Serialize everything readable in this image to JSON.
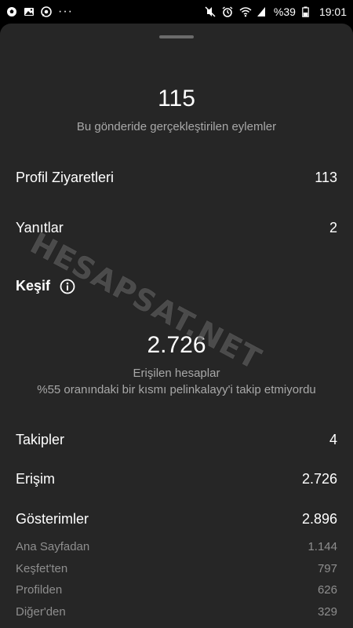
{
  "status_bar": {
    "battery": "%39",
    "time": "19:01",
    "left_icons": [
      "soccer-ball-icon",
      "gallery-icon",
      "whatsapp-icon"
    ],
    "more": "···",
    "right_icons": [
      "mute-icon",
      "alarm-icon",
      "wifi-icon",
      "signal-icon",
      "battery-icon"
    ]
  },
  "summary": {
    "actions_count": "115",
    "actions_caption": "Bu gönderide gerçekleştirilen eylemler"
  },
  "actions": [
    {
      "label": "Profil Ziyaretleri",
      "value": "113"
    },
    {
      "label": "Yanıtlar",
      "value": "2"
    }
  ],
  "discovery": {
    "title": "Keşif",
    "reach_count": "2.726",
    "reach_caption": "Erişilen hesaplar",
    "reach_note": "%55 oranındaki bir kısmı pelinkalayy'i takip etmiyordu"
  },
  "metrics": [
    {
      "label": "Takipler",
      "value": "4"
    },
    {
      "label": "Erişim",
      "value": "2.726"
    },
    {
      "label": "Gösterimler",
      "value": "2.896"
    }
  ],
  "impressions_breakdown": [
    {
      "label": "Ana Sayfadan",
      "value": "1.144"
    },
    {
      "label": "Keşfet'ten",
      "value": "797"
    },
    {
      "label": "Profilden",
      "value": "626"
    },
    {
      "label": "Diğer'den",
      "value": "329"
    }
  ],
  "watermark": "HESAPSAT.NET"
}
